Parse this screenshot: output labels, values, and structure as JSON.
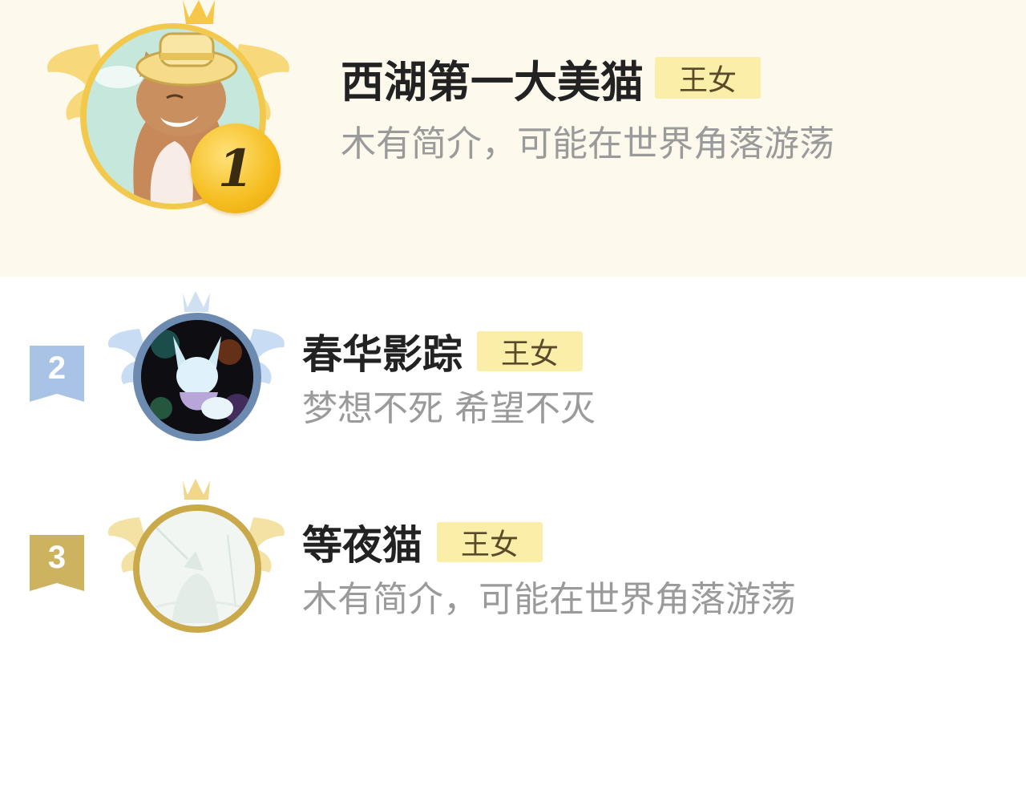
{
  "ranking": [
    {
      "rank": "1",
      "name": "西湖第一大美猫",
      "tag": "王女",
      "description": "木有简介，可能在世界角落游荡",
      "frame_color": "#f2c94c",
      "avatar_icon": "cat-with-straw-hat-avatar"
    },
    {
      "rank": "2",
      "name": "春华影踪",
      "tag": "王女",
      "description": "梦想不死 希望不灭",
      "frame_color": "#6d8bb0",
      "avatar_icon": "fox-spirit-avatar"
    },
    {
      "rank": "3",
      "name": "等夜猫",
      "tag": "王女",
      "description": "木有简介，可能在世界角落游荡",
      "frame_color": "#c9a94a",
      "avatar_icon": "pale-sketch-avatar"
    }
  ],
  "colors": {
    "top_background": "#fdf9ec",
    "tag_background": "#fbeea8",
    "gold": "#f5bd1f",
    "silver": "#a9c3e6",
    "bronze": "#cdb35f"
  }
}
